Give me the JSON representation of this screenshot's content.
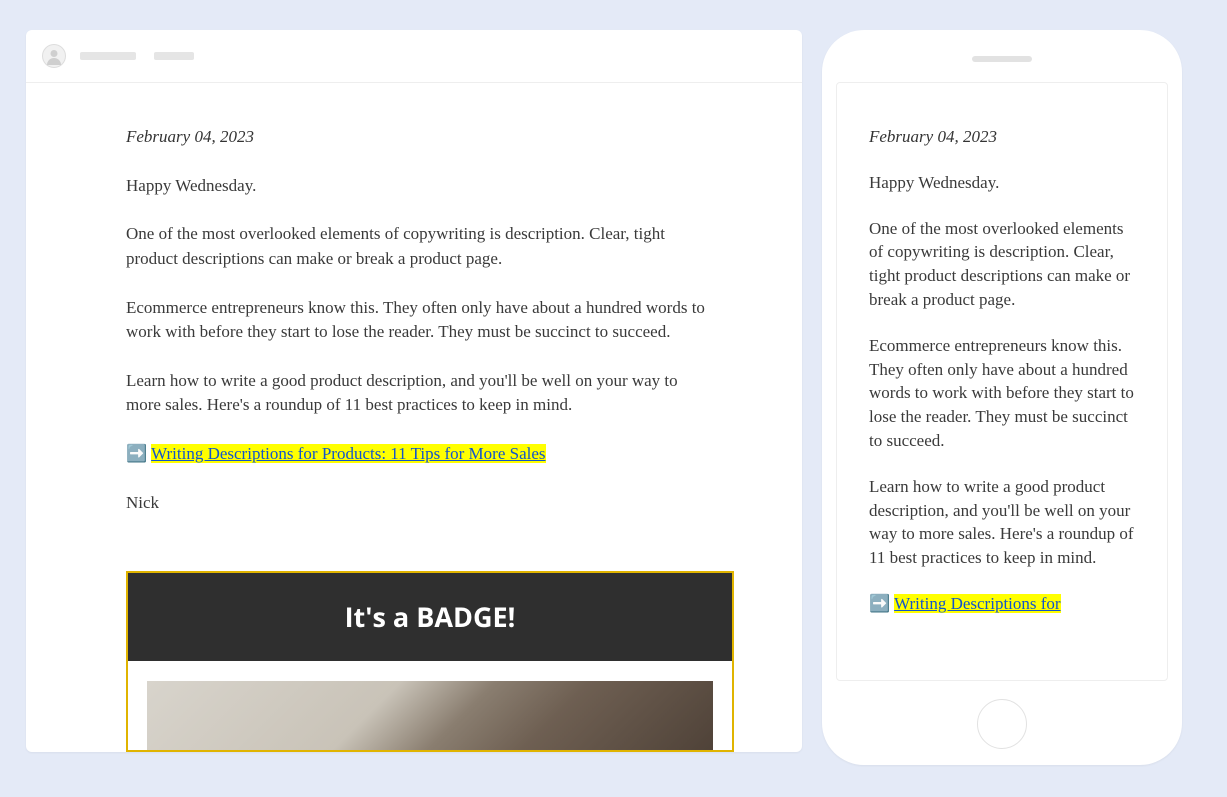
{
  "email": {
    "date": "February 04, 2023",
    "greeting": "Happy Wednesday.",
    "p1": "One of the most overlooked elements of copywriting is description. Clear, tight product descriptions can make or break a product page.",
    "p2": "Ecommerce entrepreneurs know this. They often only have about a hundred words to work with before they start to lose the reader. They must be succinct to succeed.",
    "p3": "Learn how to write a good product description, and you'll be well on your way to more sales. Here's a roundup of 11 best practices to keep in mind.",
    "link_arrow": "➡️",
    "link_text": "Writing Descriptions for Products: 11 Tips for More Sales",
    "mobile_link_text_cut": "Writing Descriptions for",
    "signoff": "Nick",
    "badge_title": "It's a BADGE!"
  }
}
